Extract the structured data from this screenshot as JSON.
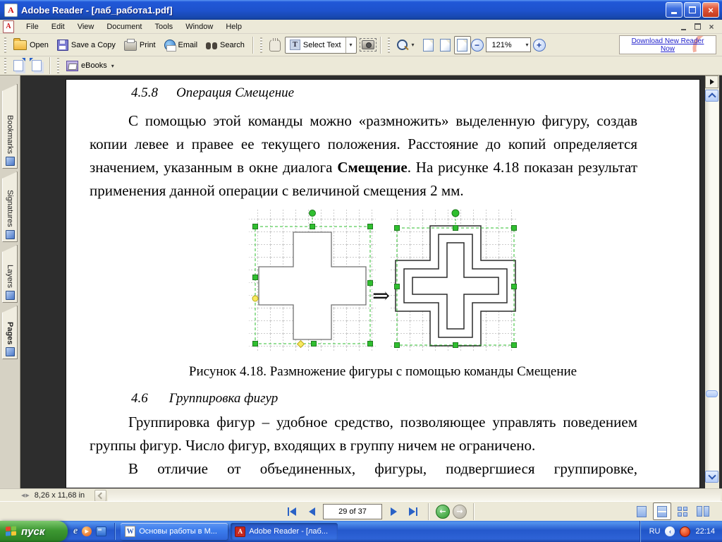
{
  "titlebar": {
    "title": "Adobe Reader - [лаб_работа1.pdf]"
  },
  "menubar": {
    "items": [
      "File",
      "Edit",
      "View",
      "Document",
      "Tools",
      "Window",
      "Help"
    ]
  },
  "toolbar": {
    "open": "Open",
    "save_copy": "Save a Copy",
    "print": "Print",
    "email": "Email",
    "search": "Search",
    "select_text": "Select Text",
    "zoom_level": "121%",
    "ad_line1": "Download New Reader",
    "ad_line2": "Now",
    "ebooks": "eBooks"
  },
  "sidebar": {
    "tabs": [
      {
        "label": "Bookmarks"
      },
      {
        "label": "Signatures"
      },
      {
        "label": "Layers"
      },
      {
        "label": "Pages",
        "active": true
      }
    ]
  },
  "page": {
    "heading1_num": "4.5.8",
    "heading1_text": "Операция Смещение",
    "para1_a": "С помощью этой команды можно «размножить» выделенную фигуру, создав копии левее и правее ее текущего положения. Расстояние до копий определяется значением, указанным в окне диалога ",
    "para1_b": "Смещение",
    "para1_c": ". На рисунке 4.18 показан результат применения данной операции с величиной смещения 2 мм.",
    "figure_arrow": "⇒",
    "figure_caption": "Рисунок 4.18. Размножение фигуры с помощью команды Смещение",
    "heading2_num": "4.6",
    "heading2_text": "Группировка фигур",
    "para2": "Группировка фигур – удобное средство, позволяющее управлять поведением группы фигур. Число фигур, входящих в группу ничем не ограничено.",
    "para3": "В отличие от объединенных, фигуры, подвергшиеся группировке,"
  },
  "statusbar": {
    "page_size": "8,26 x 11,68 in"
  },
  "navbar": {
    "page_indicator": "29 of 37"
  },
  "taskbar": {
    "start_label": "пуск",
    "tasks": [
      {
        "label": "Основы работы в М..."
      },
      {
        "label": "Adobe Reader - [лаб..."
      }
    ],
    "lang": "RU",
    "clock": "22:14"
  },
  "icons": {
    "dropdown": "▾",
    "close": "×",
    "select_text_glyph": "T",
    "adobe_glyph": "A",
    "word_glyph": "W",
    "ie_glyph": "e",
    "play_glyph": "▶",
    "back_arrow": "←",
    "forward_arrow": "→",
    "splitter": "◀▶",
    "chevron_left": "‹"
  },
  "colors": {
    "selection_green": "#2FBF2F",
    "handle_border": "#1E7A1E",
    "accent_blue": "#316AC5",
    "ad_red": "#E23D28",
    "taskbar_blue": "#2458CC",
    "start_green": "#3D9832"
  }
}
